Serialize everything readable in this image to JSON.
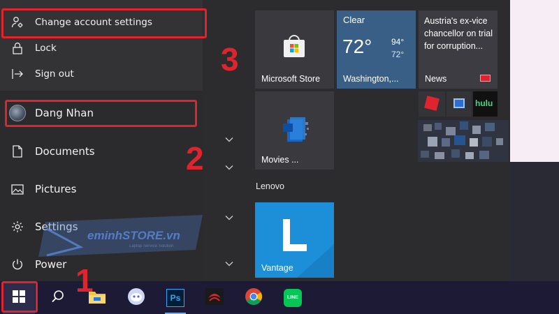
{
  "power_menu": {
    "change_account_settings": "Change account settings",
    "lock": "Lock",
    "sign_out": "Sign out"
  },
  "user": {
    "name": "Dang Nhan"
  },
  "nav": {
    "documents": "Documents",
    "pictures": "Pictures",
    "settings": "Settings",
    "power": "Power"
  },
  "steps": {
    "one": "1",
    "two": "2",
    "three": "3"
  },
  "tiles": {
    "store": {
      "label": "Microsoft Store"
    },
    "weather": {
      "condition": "Clear",
      "temp": "72°",
      "high": "94°",
      "low": "72°",
      "location": "Washington,..."
    },
    "news": {
      "headline": "Austria's ex-vice chancellor on trial for corruption...",
      "label": "News"
    },
    "movies": {
      "label": "Movies ..."
    },
    "hulu": {
      "label": "hulu"
    },
    "vantage": {
      "label": "Vantage",
      "letter": "L"
    }
  },
  "groups": {
    "lenovo": "Lenovo"
  },
  "watermark": {
    "brand": "eminhSTORE.vn",
    "tagline": "Laptop Service Solution"
  },
  "colors": {
    "highlight": "#e0242d",
    "store_tile": "#3a3a3e",
    "weather_tile": "#3a5f86",
    "vantage_tile": "#1b8fd8",
    "taskbar": "#1c1a34"
  },
  "taskbar": {
    "icons": [
      "windows-start-icon",
      "search-icon",
      "file-explorer-icon",
      "discord-icon",
      "photoshop-icon",
      "garena-icon",
      "chrome-icon",
      "line-icon"
    ],
    "photoshop_label": "Ps",
    "line_label": "LINE"
  }
}
